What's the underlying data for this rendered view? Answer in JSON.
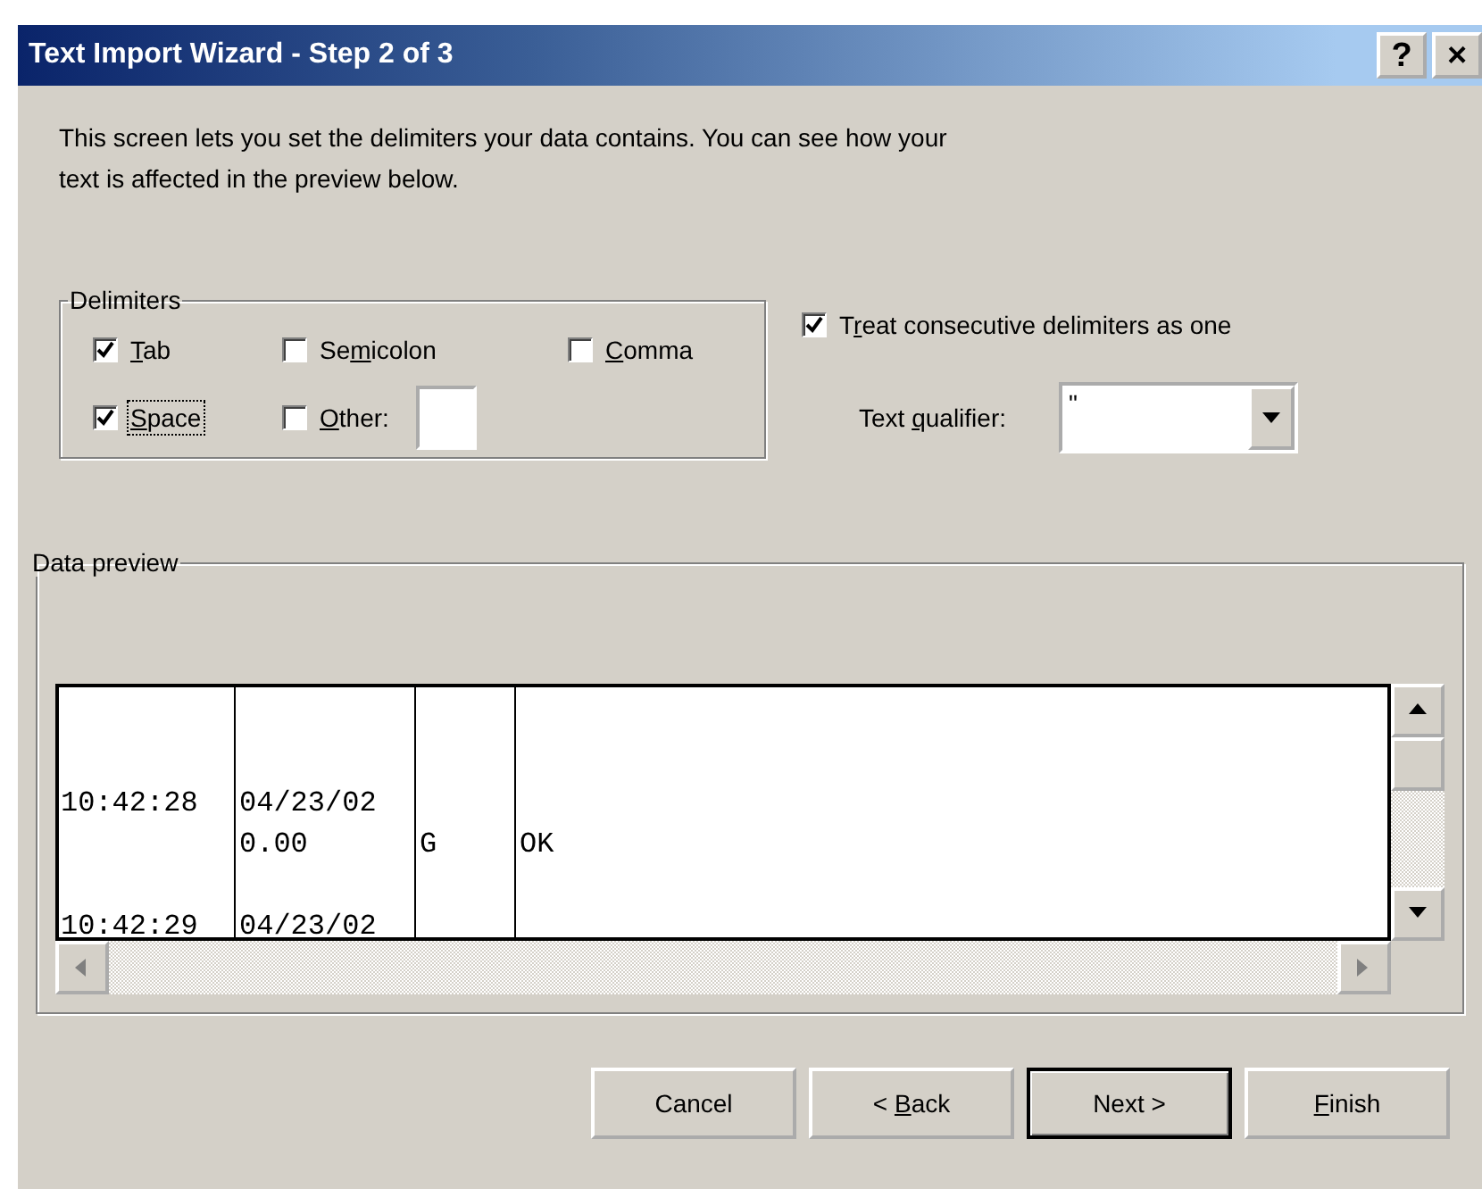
{
  "window": {
    "title": "Text Import Wizard - Step 2 of 3",
    "title_buttons": [
      "?",
      "×"
    ]
  },
  "intro": "This screen lets you set the delimiters your data contains.  You can see how your text is affected in the preview below.",
  "delimiters": {
    "legend": "Delimiters",
    "options": [
      {
        "label": {
          "key": "T",
          "after": "ab"
        },
        "checked": true,
        "focused": false
      },
      {
        "label": {
          "before": "Se",
          "key": "m",
          "after": "icolon"
        },
        "checked": false,
        "focused": false
      },
      {
        "label": {
          "key": "C",
          "after": "omma"
        },
        "checked": false,
        "focused": false
      },
      {
        "label": {
          "key": "S",
          "after": "pace"
        },
        "checked": true,
        "focused": true
      },
      {
        "label": {
          "key": "O",
          "after": "ther:"
        },
        "checked": false,
        "focused": false
      }
    ]
  },
  "treat_consecutive": {
    "label": {
      "before": "T",
      "key": "r",
      "after": "eat consecutive delimiters as one"
    },
    "checked": true
  },
  "text_qualifier": {
    "label": {
      "before": "Text ",
      "key": "q",
      "after": "ualifier:"
    },
    "value": "\""
  },
  "preview": {
    "legend": "Data preview",
    "lines": [
      {
        "kind": "blank"
      },
      {
        "kind": "blank"
      },
      {
        "kind": "text",
        "column_1": "10:42:28",
        "column_2": "04/23/02"
      },
      {
        "kind": "text",
        "column_2": "0.00",
        "column_3": "G",
        "column_4": "OK"
      },
      {
        "kind": "blank"
      },
      {
        "kind": "text",
        "column_1": "10:42:29",
        "column_2": "04/23/02"
      }
    ]
  },
  "buttons": [
    {
      "label": {
        "before": "Cancel"
      },
      "default": false
    },
    {
      "label": {
        "before": "< ",
        "key": "B",
        "after": "ack"
      },
      "default": false
    },
    {
      "label": {
        "before": "Next >"
      },
      "default": true
    },
    {
      "label": {
        "key": "F",
        "after": "inish"
      },
      "default": false
    }
  ]
}
